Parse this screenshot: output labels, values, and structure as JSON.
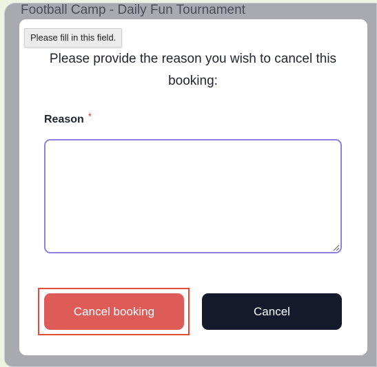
{
  "background": {
    "title": "Football Camp - Daily Fun Tournament"
  },
  "tooltip": {
    "text": "Please fill in this field."
  },
  "modal": {
    "prompt": "Please provide the reason you wish to cancel this booking:",
    "reason_label": "Reason",
    "required_mark": "*",
    "reason_value": "",
    "buttons": {
      "cancel_booking": "Cancel booking",
      "cancel": "Cancel"
    }
  },
  "colors": {
    "cancel_booking_bg": "#de5c58",
    "cancel_bg": "#141a2b",
    "input_focus_border": "#8b7fe0",
    "highlight_border": "#e24d3b"
  }
}
